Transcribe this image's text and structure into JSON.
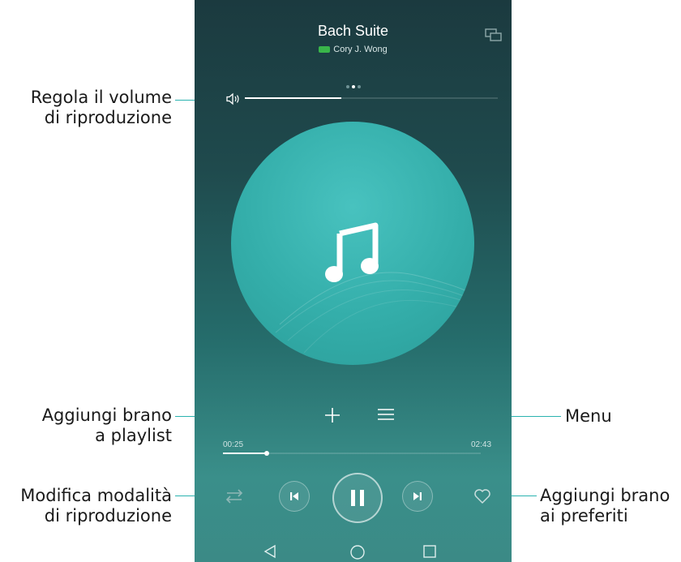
{
  "player": {
    "song_title": "Bach Suite",
    "quality_badge": "SQ",
    "artist": "Cory J. Wong",
    "volume_level": 0.38,
    "current_page": 2,
    "page_count": 3,
    "elapsed_time": "00:25",
    "total_time": "02:43",
    "progress_fraction": 0.17
  },
  "annotations": {
    "volume": [
      "Regola il volume",
      "di riproduzione"
    ],
    "add_playlist": [
      "Aggiungi brano",
      "a playlist"
    ],
    "menu": [
      "Menu"
    ],
    "play_mode": [
      "Modifica modalità",
      "di riproduzione"
    ],
    "favorites": [
      "Aggiungi brano",
      "ai preferiti"
    ]
  },
  "icons": {
    "cast": "cast-icon",
    "volume": "volume-icon",
    "cover": "music-note-icon",
    "add": "plus-icon",
    "menu": "menu-icon",
    "play_mode": "shuffle-icon",
    "previous": "skip-previous-icon",
    "pause": "pause-icon",
    "next": "skip-next-icon",
    "favorite": "heart-icon",
    "back": "back-icon",
    "home": "home-icon",
    "recents": "recents-icon"
  },
  "colors": {
    "accent": "#2bb3b0",
    "background_top": "#1b3a3f",
    "background_bottom": "#3b8a86",
    "cover": "#3ab4b0"
  }
}
